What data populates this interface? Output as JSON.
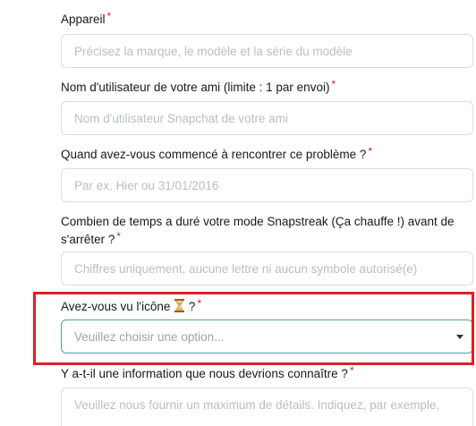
{
  "fields": {
    "device": {
      "label": "Appareil",
      "required_mark": "*",
      "placeholder": "Précisez la marque, le modèle et la série du modèle"
    },
    "friend_username": {
      "label": "Nom d'utilisateur de votre ami (limite : 1 par envoi)",
      "required_mark": "*",
      "placeholder": "Nom d'utilisateur Snapchat de votre ami"
    },
    "start_date": {
      "label": "Quand avez-vous commencé à rencontrer ce problème ?",
      "required_mark": "*",
      "placeholder": "Par ex. Hier ou 31/01/2016"
    },
    "streak_duration": {
      "label_line1": "Combien de temps a duré votre mode Snapstreak (Ça chauffe !) avant de",
      "label_line2": "s'arrêter ?",
      "required_mark": "*",
      "placeholder": "Chiffres uniquement, aucune lettre ni aucun symbole autorisé(e)"
    },
    "hourglass_seen": {
      "label_before": "Avez-vous vu l'icône",
      "label_after": "?",
      "required_mark": "*",
      "icon": "hourglass-icon",
      "placeholder": "Veuillez choisir une option..."
    },
    "additional_info": {
      "label": "Y a-t-il une information que nous devrions connaître ?",
      "required_mark": "*",
      "placeholder": "Veuillez nous fournir un maximum de détails. Indiquez, par exemple,"
    }
  },
  "colors": {
    "required": "#d61f2c",
    "highlight_box": "#d8232a",
    "select_border": "#5a9aa6"
  }
}
